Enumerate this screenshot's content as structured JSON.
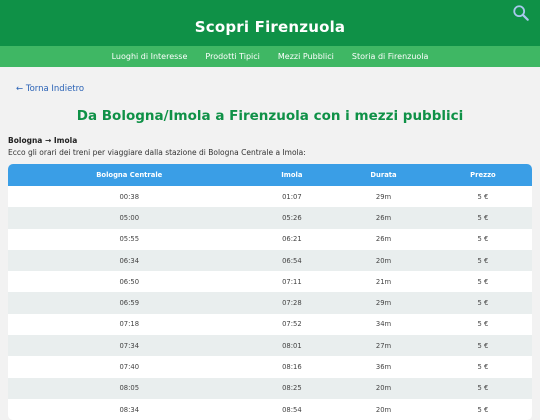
{
  "header": {
    "title": "Scopri Firenzuola"
  },
  "nav": {
    "items": [
      "Luoghi di Interesse",
      "Prodotti Tipici",
      "Mezzi Pubblici",
      "Storia di Firenzuola"
    ]
  },
  "back_link": "← Torna Indietro",
  "page_title": "Da Bologna/Imola a Firenzuola con i mezzi pubblici",
  "route_label": "Bologna → Imola",
  "description": "Ecco gli orari dei treni per viaggiare dalla stazione di Bologna Centrale a Imola:",
  "table": {
    "columns": [
      "Bologna Centrale",
      "Imola",
      "Durata",
      "Prezzo"
    ],
    "rows": [
      [
        "00:38",
        "01:07",
        "29m",
        "5 €"
      ],
      [
        "05:00",
        "05:26",
        "26m",
        "5 €"
      ],
      [
        "05:55",
        "06:21",
        "26m",
        "5 €"
      ],
      [
        "06:34",
        "06:54",
        "20m",
        "5 €"
      ],
      [
        "06:50",
        "07:11",
        "21m",
        "5 €"
      ],
      [
        "06:59",
        "07:28",
        "29m",
        "5 €"
      ],
      [
        "07:18",
        "07:52",
        "34m",
        "5 €"
      ],
      [
        "07:34",
        "08:01",
        "27m",
        "5 €"
      ],
      [
        "07:40",
        "08:16",
        "36m",
        "5 €"
      ],
      [
        "08:05",
        "08:25",
        "20m",
        "5 €"
      ],
      [
        "08:34",
        "08:54",
        "20m",
        "5 €"
      ]
    ]
  },
  "colors": {
    "header": "#0f9147",
    "nav": "#3fb764",
    "table_header": "#3a9ee6",
    "link": "#2b63b6"
  }
}
